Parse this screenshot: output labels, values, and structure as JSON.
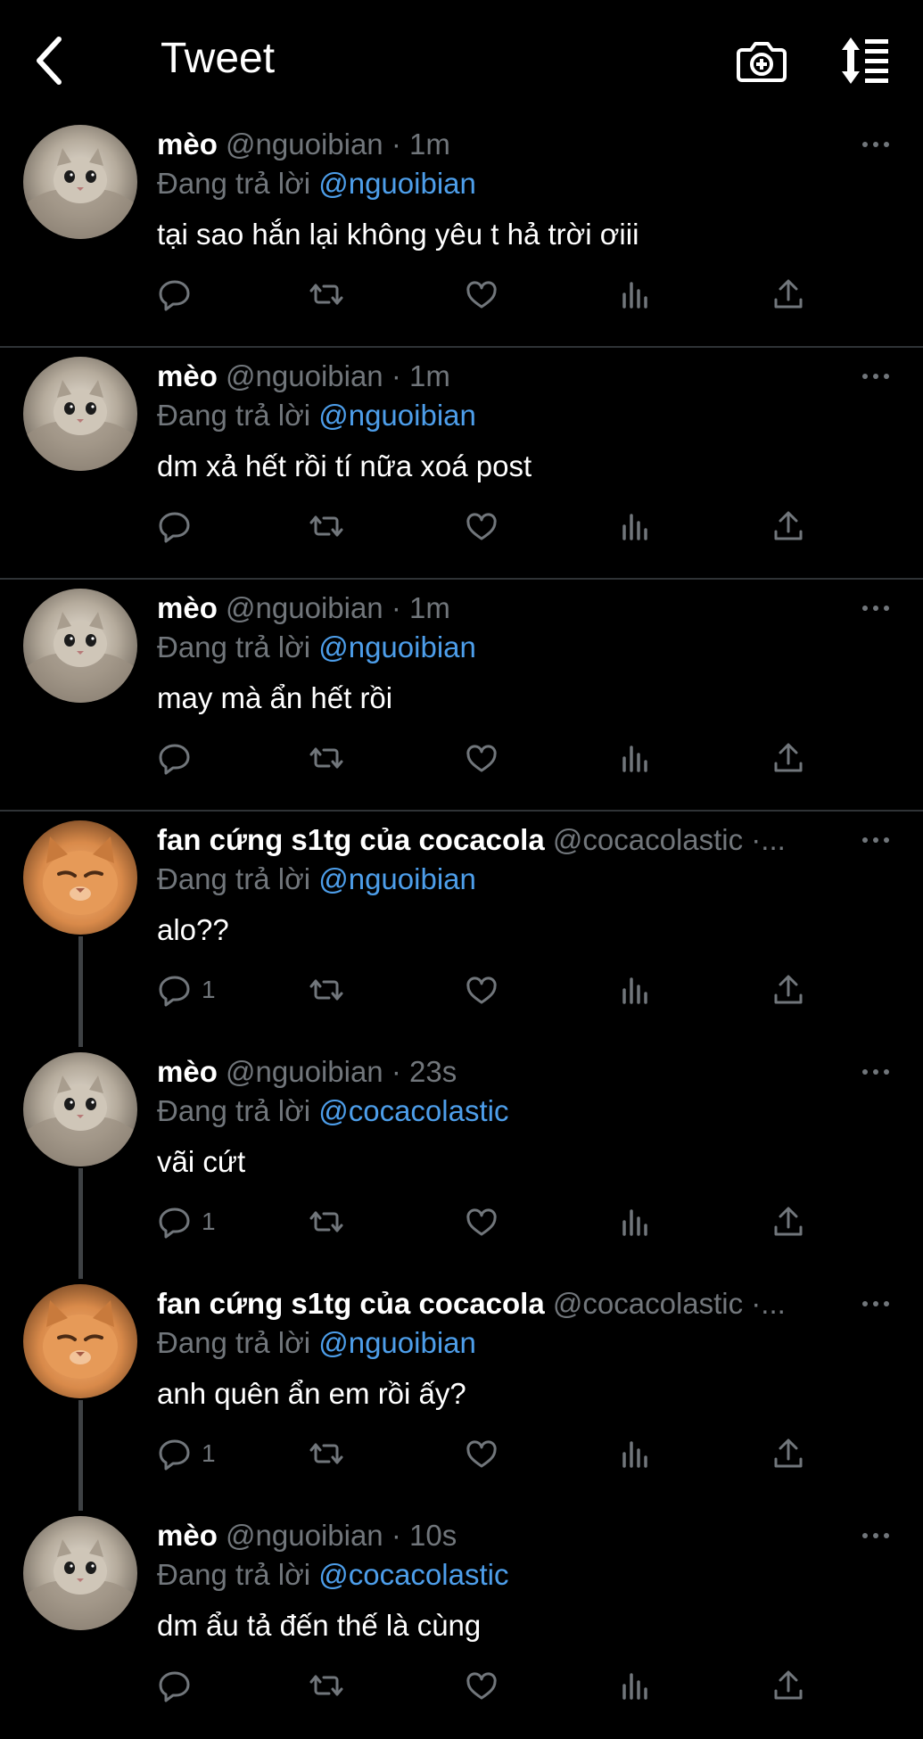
{
  "header": {
    "title": "Tweet"
  },
  "tweets": [
    {
      "name": "mèo",
      "handle": "@nguoibian · 1m",
      "reply_prefix": "Đang trả lời",
      "reply_to": "@nguoibian",
      "text": "tại sao hắn lại không yêu t hả trời ơiii",
      "reply_count": ""
    },
    {
      "name": "mèo",
      "handle": "@nguoibian · 1m",
      "reply_prefix": "Đang trả lời",
      "reply_to": "@nguoibian",
      "text": "dm xả hết rồi tí nữa xoá post",
      "reply_count": ""
    },
    {
      "name": "mèo",
      "handle": "@nguoibian · 1m",
      "reply_prefix": "Đang trả lời",
      "reply_to": "@nguoibian",
      "text": "may mà ẩn hết rồi",
      "reply_count": ""
    },
    {
      "name": "fan cứng s1tg của cocacola",
      "handle": "@cocacolastic ·...",
      "reply_prefix": "Đang trả lời",
      "reply_to": "@nguoibian",
      "text": "alo??",
      "reply_count": "1"
    },
    {
      "name": "mèo",
      "handle": "@nguoibian · 23s",
      "reply_prefix": "Đang trả lời",
      "reply_to": "@cocacolastic",
      "text": "vãi cứt",
      "reply_count": "1"
    },
    {
      "name": "fan cứng s1tg của cocacola",
      "handle": "@cocacolastic ·...",
      "reply_prefix": "Đang trả lời",
      "reply_to": "@nguoibian",
      "text": "anh quên ẩn em rồi ấy?",
      "reply_count": "1"
    },
    {
      "name": "mèo",
      "handle": "@nguoibian · 10s",
      "reply_prefix": "Đang trả lời",
      "reply_to": "@cocacolastic",
      "text": "dm ẩu tả đến thế là cùng",
      "reply_count": ""
    }
  ],
  "colors": {
    "background": "#000000",
    "text": "#e7e9ea",
    "muted": "#71767b",
    "mention": "#4d9eea",
    "divider": "#2f3336"
  }
}
